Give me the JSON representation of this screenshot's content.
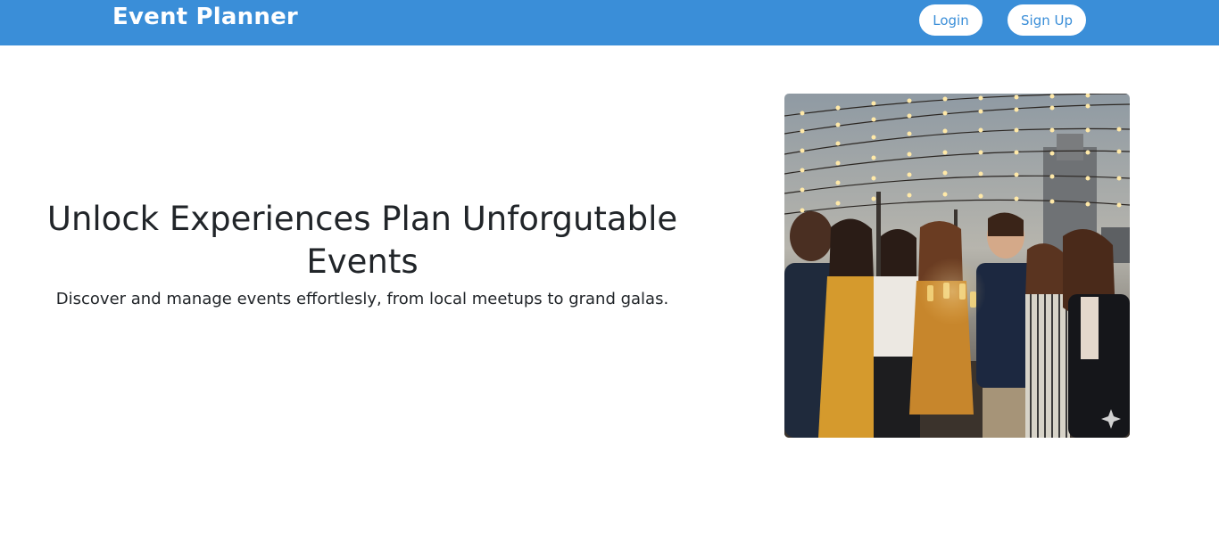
{
  "navbar": {
    "brand": "Event Planner",
    "login_label": "Login",
    "signup_label": "Sign Up",
    "background_color": "#3a8ed8"
  },
  "hero": {
    "title": "Unlock Experiences Plan Unforgutable Events",
    "subtitle": "Discover and manage events effortlesly, from local meetups to grand galas.",
    "image_alt": "group-of-friends-toasting-champagne-under-string-lights-icon"
  }
}
